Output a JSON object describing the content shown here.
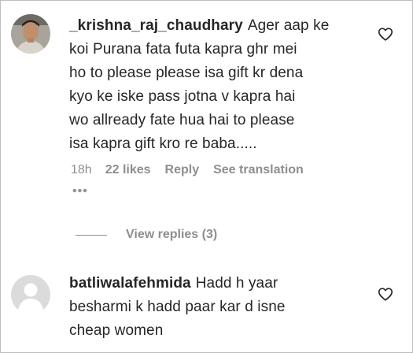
{
  "comments": [
    {
      "username": "_krishna_raj_chaudhary",
      "lines": [
        "Ager aap ke",
        "koi Purana fata futa kapra ghr mei",
        "ho to please please isa gift kr dena",
        "kyo ke iske pass jotna v kapra hai",
        "wo allready fate hua hai to please",
        "isa kapra gift kro re baba....."
      ],
      "time": "18h",
      "likes": "22 likes",
      "reply_label": "Reply",
      "translate_label": "See translation",
      "more_label": "•••",
      "replies_label": "View replies (3)",
      "heart_icon": "heart-outline-icon"
    },
    {
      "username": "batliwalafehmida",
      "lines": [
        "Hadd h yaar",
        "besharmi k hadd paar kar d isne",
        "cheap women"
      ],
      "heart_icon": "heart-outline-icon"
    }
  ],
  "colors": {
    "text": "#262626",
    "secondary": "#8e8e8e",
    "divider": "#bdbdbd"
  }
}
